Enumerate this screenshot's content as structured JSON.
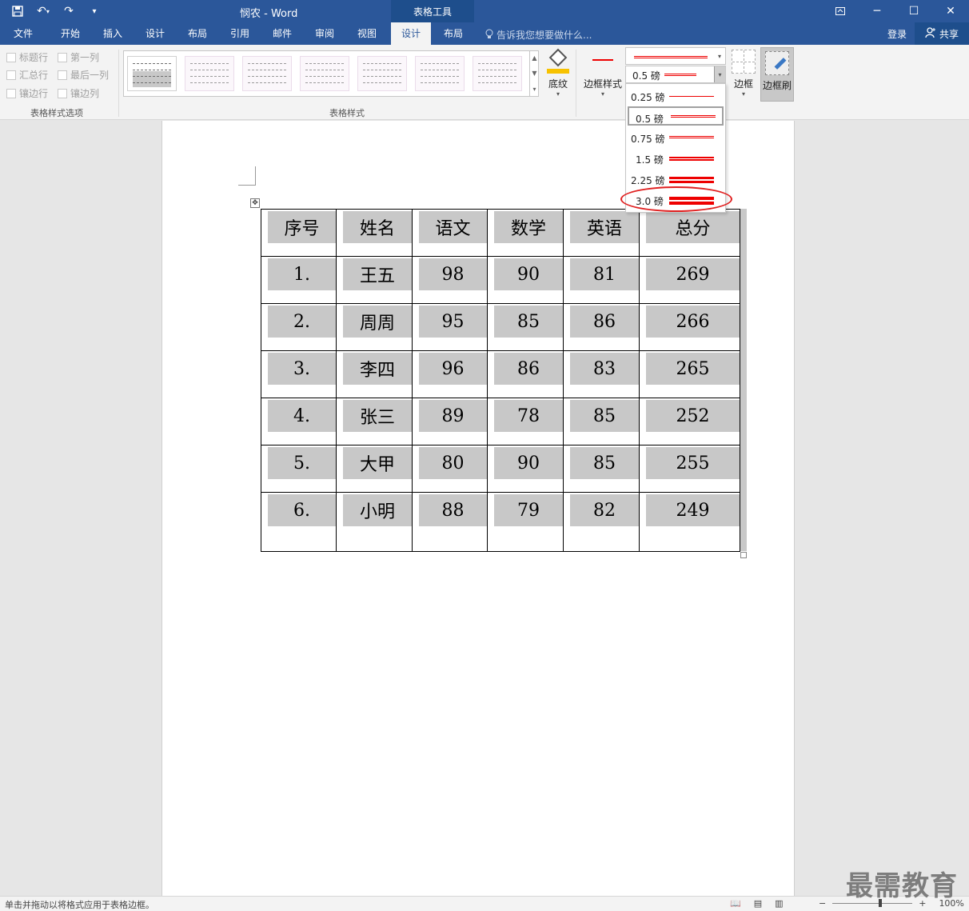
{
  "titlebar": {
    "doc_title": "悯农 - Word",
    "context_group": "表格工具",
    "qat": {
      "save_icon": "save-icon",
      "undo_icon": "undo-icon",
      "redo_icon": "redo-icon",
      "customize_icon": "customize-qat-icon"
    }
  },
  "tabs": [
    {
      "label": "文件"
    },
    {
      "label": "开始"
    },
    {
      "label": "插入"
    },
    {
      "label": "设计"
    },
    {
      "label": "布局"
    },
    {
      "label": "引用"
    },
    {
      "label": "邮件"
    },
    {
      "label": "审阅"
    },
    {
      "label": "视图"
    },
    {
      "label": "设计"
    },
    {
      "label": "布局"
    }
  ],
  "tellme": "告诉我您想要做什么...",
  "login": "登录",
  "share": "共享",
  "ribbon": {
    "options": [
      "标题行",
      "第一列",
      "汇总行",
      "最后一列",
      "镶边行",
      "镶边列"
    ],
    "options_group": "表格样式选项",
    "styles_group": "表格样式",
    "shading": "底纹",
    "border_styles": "边框样式",
    "pen_weight": "0.5 磅",
    "borders": "边框",
    "border_painter": "边框刷"
  },
  "weight_dropdown": {
    "items": [
      "0.25 磅",
      "0.5 磅",
      "0.75 磅",
      "1.5 磅",
      "2.25 磅",
      "3.0 磅"
    ],
    "selected_index": 1,
    "highlighted_index": 5
  },
  "table": {
    "headers": [
      "序号",
      "姓名",
      "语文",
      "数学",
      "英语",
      "总分"
    ],
    "rows": [
      [
        "1.",
        "王五",
        "98",
        "90",
        "81",
        "269"
      ],
      [
        "2.",
        "周周",
        "95",
        "85",
        "86",
        "266"
      ],
      [
        "3.",
        "李四",
        "96",
        "86",
        "83",
        "265"
      ],
      [
        "4.",
        "张三",
        "89",
        "78",
        "85",
        "252"
      ],
      [
        "5.",
        "大甲",
        "80",
        "90",
        "85",
        "255"
      ],
      [
        "6.",
        "小明",
        "88",
        "79",
        "82",
        "249"
      ]
    ]
  },
  "status": {
    "text": "单击并拖动以将格式应用于表格边框。",
    "zoom_minus": "−",
    "zoom_plus": "+",
    "zoom": "100%"
  },
  "watermark": "最需教育"
}
